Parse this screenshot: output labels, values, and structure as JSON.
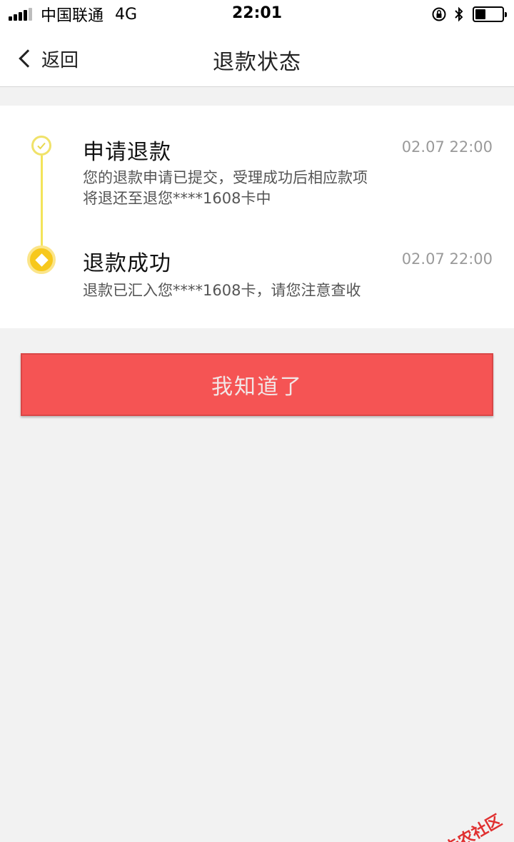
{
  "status_bar": {
    "carrier": "中国联通",
    "network": "4G",
    "time": "22:01",
    "icons": [
      "orientation-lock-icon",
      "bluetooth-icon",
      "battery-icon"
    ],
    "battery_level": 0.4
  },
  "nav": {
    "back_label": "返回",
    "title": "退款状态"
  },
  "timeline": {
    "steps": [
      {
        "title": "申请退款",
        "time": "02.07 22:00",
        "desc_line1": "您的退款申请已提交，受理成功后相应款项",
        "desc_line2": "将退还至退您****1608卡中",
        "icon": "check-circle-icon"
      },
      {
        "title": "退款成功",
        "time": "02.07 22:00",
        "desc_line1": "退款已汇入您****1608卡，请您注意查收",
        "icon": "coin-icon"
      }
    ],
    "accent_color": "#f7c81c"
  },
  "confirm_button": {
    "label": "我知道了",
    "color": "#f55454"
  },
  "watermark": {
    "text": "卡农社区"
  }
}
